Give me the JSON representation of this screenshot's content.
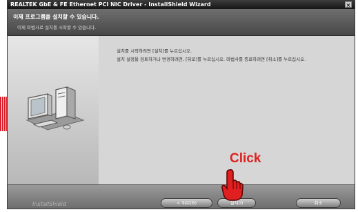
{
  "window": {
    "title": "REALTEK GbE & FE Ethernet PCI NIC Driver - InstallShield Wizard",
    "close_glyph": "×"
  },
  "header": {
    "title": "이제 프로그램을 설치할 수 있습니다.",
    "subtitle": "이제 마법사로 설치를 시작할 수 있습니다."
  },
  "content": {
    "line1": "설치를 시작하려면 [설치]를 누르십시오.",
    "line2": "설치 설정을 검토하거나 변경하려면, [뒤로]를 누르십시오. 마법사를 종료하려면 [취소]를 누르십시오."
  },
  "footer": {
    "brand": "InstallShield",
    "back_label": "< 뒤로(B)",
    "install_label": "설치(I)",
    "cancel_label": "취소"
  },
  "annotation": {
    "click_label": "Click",
    "hand_icon": "pointing-hand-icon",
    "color": "#e02020"
  },
  "colors": {
    "accent_red": "#d8202a"
  }
}
